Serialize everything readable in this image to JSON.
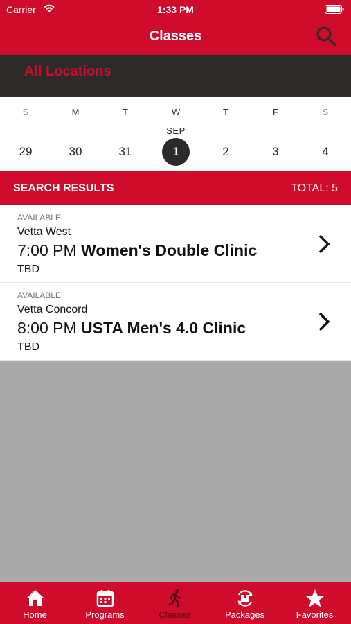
{
  "status_bar": {
    "carrier": "Carrier",
    "time": "1:33 PM"
  },
  "nav": {
    "title": "Classes"
  },
  "location": {
    "label": "All Locations"
  },
  "calendar": {
    "month": "SEP",
    "days": [
      {
        "dow": "S",
        "day": "29"
      },
      {
        "dow": "M",
        "day": "30"
      },
      {
        "dow": "T",
        "day": "31"
      },
      {
        "dow": "W",
        "day": "1"
      },
      {
        "dow": "T",
        "day": "2"
      },
      {
        "dow": "F",
        "day": "3"
      },
      {
        "dow": "S",
        "day": "4"
      }
    ],
    "selected_index": 3
  },
  "results": {
    "title": "SEARCH RESULTS",
    "total": "TOTAL: 5"
  },
  "classes": [
    {
      "status": "AVAILABLE",
      "location": "Vetta West",
      "time": "7:00 PM",
      "name": "Women's Double Clinic",
      "instructor": "TBD"
    },
    {
      "status": "AVAILABLE",
      "location": "Vetta Concord",
      "time": "8:00 PM",
      "name": "USTA Men's 4.0 Clinic",
      "instructor": "TBD"
    }
  ],
  "tabs": [
    {
      "label": "Home",
      "icon": "home-icon"
    },
    {
      "label": "Programs",
      "icon": "calendar-icon"
    },
    {
      "label": "Classes",
      "icon": "running-person-icon"
    },
    {
      "label": "Packages",
      "icon": "package-icon"
    },
    {
      "label": "Favorites",
      "icon": "star-icon"
    }
  ],
  "active_tab": "Classes",
  "colors": {
    "brand_red": "#cf0c2b",
    "dark_bar": "#2d2b29",
    "empty_area": "#aaaaaa"
  }
}
